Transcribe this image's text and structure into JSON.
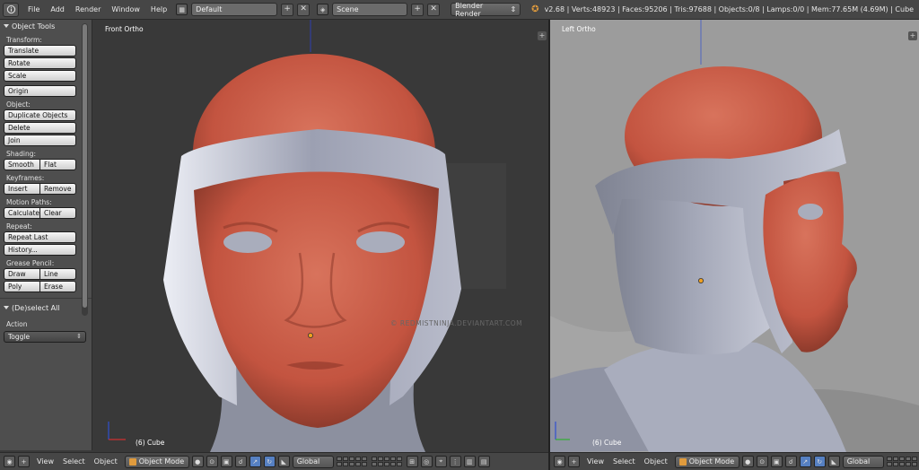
{
  "header": {
    "menus": [
      "File",
      "Add",
      "Render",
      "Window",
      "Help"
    ],
    "screen_layout": "Default",
    "scene": "Scene",
    "render_engine": "Blender Render",
    "stats": "v2.68 | Verts:48923 | Faces:95206 | Tris:97688 | Objects:0/8 | Lamps:0/0 | Mem:77.65M (4.69M) | Cube"
  },
  "toolshelf": {
    "title": "Object Tools",
    "transform_label": "Transform:",
    "translate": "Translate",
    "rotate": "Rotate",
    "scale": "Scale",
    "origin": "Origin",
    "object_label": "Object:",
    "duplicate": "Duplicate Objects",
    "delete": "Delete",
    "join": "Join",
    "shading_label": "Shading:",
    "smooth": "Smooth",
    "flat": "Flat",
    "keyframes_label": "Keyframes:",
    "insert": "Insert",
    "remove": "Remove",
    "motion_label": "Motion Paths:",
    "calculate": "Calculate",
    "clear": "Clear",
    "repeat_label": "Repeat:",
    "repeat_last": "Repeat Last",
    "history": "History...",
    "grease_label": "Grease Pencil:",
    "draw": "Draw",
    "line": "Line",
    "poly": "Poly",
    "erase": "Erase",
    "operator_title": "(De)select All",
    "action_label": "Action",
    "action_value": "Toggle"
  },
  "viewport_front": {
    "label": "Front Ortho",
    "object": "(6) Cube"
  },
  "viewport_left": {
    "label": "Left Ortho",
    "object": "(6) Cube"
  },
  "watermark": "© REDMISTNINJA.DEVIANTART.COM",
  "bottom_left": {
    "menus": [
      "View",
      "Select",
      "Object"
    ],
    "mode": "Object Mode",
    "orientation": "Global"
  },
  "bottom_right": {
    "menus": [
      "View",
      "Select",
      "Object"
    ],
    "mode": "Object Mode",
    "orientation": "Global"
  },
  "colors": {
    "skin": "#c65440",
    "helmet": "#9b9fb0",
    "origin_dot": "#f0a020"
  }
}
